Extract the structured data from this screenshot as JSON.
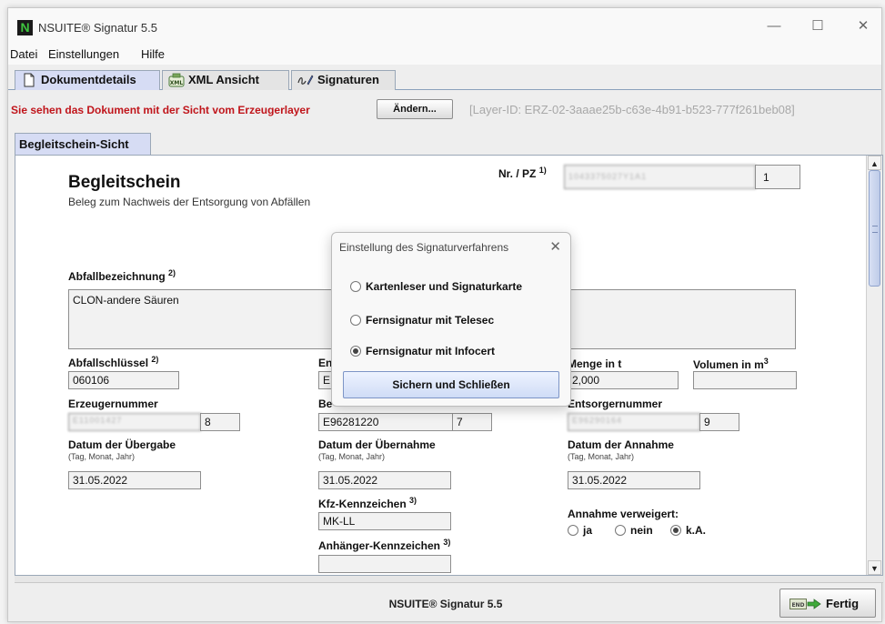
{
  "window": {
    "title": "NSUITE® Signatur 5.5",
    "app_icon_letter": "N",
    "min_glyph": "—",
    "max_glyph": "☐",
    "close_glyph": "✕"
  },
  "menu": {
    "items": [
      "Datei",
      "Einstellungen",
      "Hilfe"
    ]
  },
  "tabs": [
    {
      "label": "Dokumentdetails",
      "icon": "document-icon"
    },
    {
      "label": "XML Ansicht",
      "icon": "xml-icon"
    },
    {
      "label": "Signaturen",
      "icon": "signature-pen-icon"
    }
  ],
  "info": {
    "text": "Sie sehen das Dokument mit der Sicht vom Erzeugerlayer",
    "change_button": "Ändern...",
    "layer_id": "[Layer-ID: ERZ-02-3aaae25b-c63e-4b91-b523-777f261beb08]"
  },
  "subtab": "Begleitschein-Sicht",
  "document": {
    "title": "Begleitschein",
    "subtitle": "Beleg zum Nachweis der Entsorgung von Abfällen",
    "nr_label": "Nr. / PZ",
    "nr_sup": "1)",
    "nr_value": "1043375027Y1A1",
    "nr_pz": "1",
    "abfallbezeichnung_label": "Abfallbezeichnung",
    "abfallbezeichnung_sup": "2)",
    "abfallbezeichnung_value": "CLON-andere Säuren",
    "abfallschluessel_label": "Abfallschlüssel",
    "abfallschluessel_sup": "2)",
    "abfallschluessel_value": "060106",
    "en_label": "En",
    "en_value": "EN",
    "menge_label": "Menge in t",
    "menge_value": "2,000",
    "volumen_label": "Volumen in m",
    "volumen_sup": "3",
    "volumen_value": "",
    "erzeugernummer_label": "Erzeugernummer",
    "erzeugernummer_value": "E11001427",
    "erzeugernummer_pz": "8",
    "be_label": "Be",
    "be_value": "E96281220",
    "be_pz": "7",
    "entsorgernummer_label": "Entsorgernummer",
    "entsorgernummer_value": "E96290164",
    "entsorgernummer_pz": "9",
    "uebergabe_label": "Datum der Übergabe",
    "uebergabe_sub": "(Tag, Monat, Jahr)",
    "uebergabe_value": "31.05.2022",
    "uebernahme_label": "Datum der Übernahme",
    "uebernahme_sub": "(Tag, Monat, Jahr)",
    "uebernahme_value": "31.05.2022",
    "annahme_label": "Datum der Annahme",
    "annahme_sub": "(Tag, Monat, Jahr)",
    "annahme_value": "31.05.2022",
    "kfz_label": "Kfz-Kennzeichen",
    "kfz_sup": "3)",
    "kfz_value": "MK-LL",
    "annahme_verweigert_label": "Annahme verweigert:",
    "verweigert_options": [
      "ja",
      "nein",
      "k.A."
    ],
    "verweigert_selected": "k.A.",
    "anhaenger_label": "Anhänger-Kennzeichen",
    "anhaenger_sup": "3)",
    "anhaenger_value": ""
  },
  "dialog": {
    "title": "Einstellung des Signaturverfahrens",
    "close_glyph": "✕",
    "options": [
      "Kartenleser und Signaturkarte",
      "Fernsignatur mit Telesec",
      "Fernsignatur mit Infocert"
    ],
    "selected": "Fernsignatur mit Infocert",
    "save_button": "Sichern und Schließen"
  },
  "footer": {
    "text": "NSUITE® Signatur 5.5",
    "done_button": "Fertig"
  },
  "scroll": {
    "up_glyph": "▲",
    "down_glyph": "▼"
  }
}
